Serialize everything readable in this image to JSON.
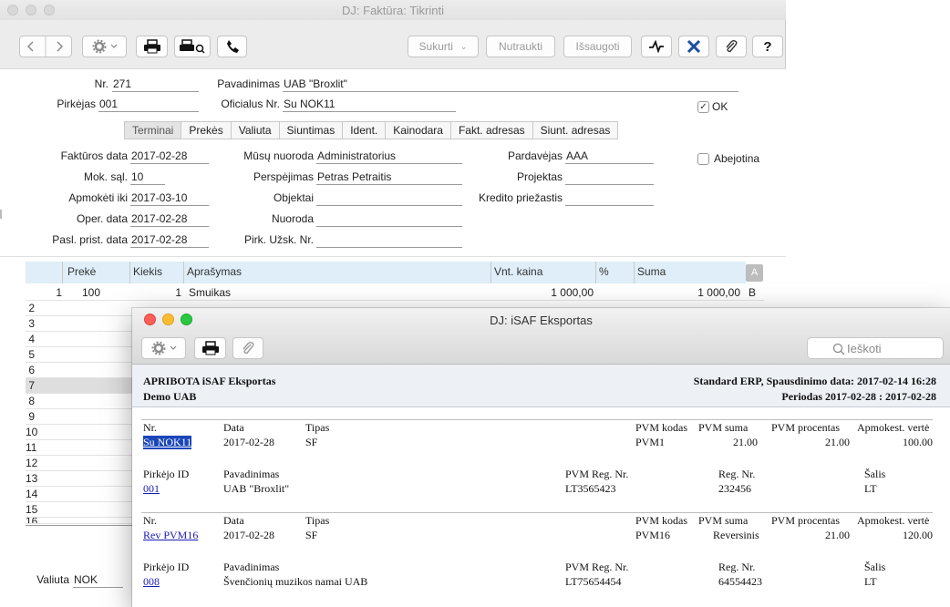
{
  "back_window": {
    "title": "DJ: Faktūra: Tikrinti",
    "toolbar": {
      "sukurti": "Sukurti",
      "nutraukti": "Nutraukti",
      "issaugoti": "Išsaugoti",
      "help": "?"
    },
    "form": {
      "nr_label": "Nr.",
      "nr_value": "271",
      "pavadinimas_label": "Pavadinimas",
      "pavadinimas_value": "UAB \"Broxlit\"",
      "pirkejas_label": "Pirkėjas",
      "pirkejas_value": "001",
      "oficialus_label": "Oficialus Nr.",
      "oficialus_value": "Su NOK11",
      "ok_label": "OK",
      "tabs": [
        "Terminai",
        "Prekės",
        "Valiuta",
        "Siuntimas",
        "Ident.",
        "Kainodara",
        "Fakt. adresas",
        "Siunt. adresas"
      ],
      "fakturos_data_label": "Faktūros data",
      "fakturos_data_value": "2017-02-28",
      "mok_sal_label": "Mok. sąl.",
      "mok_sal_value": "10",
      "apmoketi_iki_label": "Apmokėti iki",
      "apmoketi_iki_value": "2017-03-10",
      "oper_data_label": "Oper. data",
      "oper_data_value": "2017-02-28",
      "pasl_prist_label": "Pasl. prist. data",
      "pasl_prist_value": "2017-02-28",
      "musu_nuoroda_label": "Mūsų nuoroda",
      "musu_nuoroda_value": "Administratorius",
      "perspejimas_label": "Perspėjimas",
      "perspejimas_value": "Petras Petraitis",
      "objektai_label": "Objektai",
      "nuoroda_label": "Nuoroda",
      "pirk_uzsk_label": "Pirk. Užsk. Nr.",
      "pardavejas_label": "Pardavėjas",
      "pardavejas_value": "AAA",
      "projektas_label": "Projektas",
      "kredito_label": "Kredito priežastis",
      "abejotina_label": "Abejotina",
      "valiuta_label": "Valiuta",
      "valiuta_value": "NOK"
    },
    "grid": {
      "headers": [
        "Prekė",
        "Kiekis",
        "Aprašymas",
        "Vnt. kaina",
        "%",
        "Suma"
      ],
      "a_label": "A",
      "row1": {
        "num": "1",
        "preke": "100",
        "kiekis": "1",
        "aprasymas": "Smuikas",
        "kaina": "1 000,00",
        "suma": "1 000,00",
        "flag": "B"
      },
      "row_numbers": [
        "2",
        "3",
        "4",
        "5",
        "6",
        "7",
        "8",
        "9",
        "10",
        "11",
        "12",
        "13",
        "14",
        "15",
        "16"
      ]
    }
  },
  "front_window": {
    "title": "DJ: iSAF Eksportas",
    "search_placeholder": "Ieškoti",
    "report": {
      "title_left": "APRIBOTA iSAF Eksportas",
      "company": "Demo UAB",
      "title_right": "Standard ERP, Spausdinimo data: 2017-02-14 16:28",
      "period": "Periodas  2017-02-28 : 2017-02-28",
      "headers": {
        "nr": "Nr.",
        "data": "Data",
        "tipas": "Tipas",
        "pvm_kodas": "PVM kodas",
        "pvm_suma": "PVM suma",
        "pvm_procentas": "PVM procentas",
        "apmokest_verte": "Apmokest. vertė",
        "pirkejo_id": "Pirkėjo ID",
        "pavadinimas": "Pavadinimas",
        "pvm_reg_nr": "PVM Reg. Nr.",
        "reg_nr": "Reg. Nr.",
        "salis": "Šalis"
      },
      "records": [
        {
          "nr": "Su NOK11",
          "data": "2017-02-28",
          "tipas": "SF",
          "pvm_kodas": "PVM1",
          "pvm_suma": "21.00",
          "pvm_procentas": "21.00",
          "apmokest_verte": "100.00",
          "pirkejo_id": "001",
          "pavadinimas": "UAB \"Broxlit\"",
          "pvm_reg_nr": "LT3565423",
          "reg_nr": "232456",
          "salis": "LT"
        },
        {
          "nr": "Rev PVM16",
          "data": "2017-02-28",
          "tipas": "SF",
          "pvm_kodas": "PVM16",
          "pvm_suma": "Reversinis",
          "pvm_procentas": "21.00",
          "apmokest_verte": "120.00",
          "pirkejo_id": "008",
          "pavadinimas": "Švenčionių muzikos namai UAB",
          "pvm_reg_nr": "LT75654454",
          "reg_nr": "64554423",
          "salis": "LT"
        }
      ]
    }
  }
}
